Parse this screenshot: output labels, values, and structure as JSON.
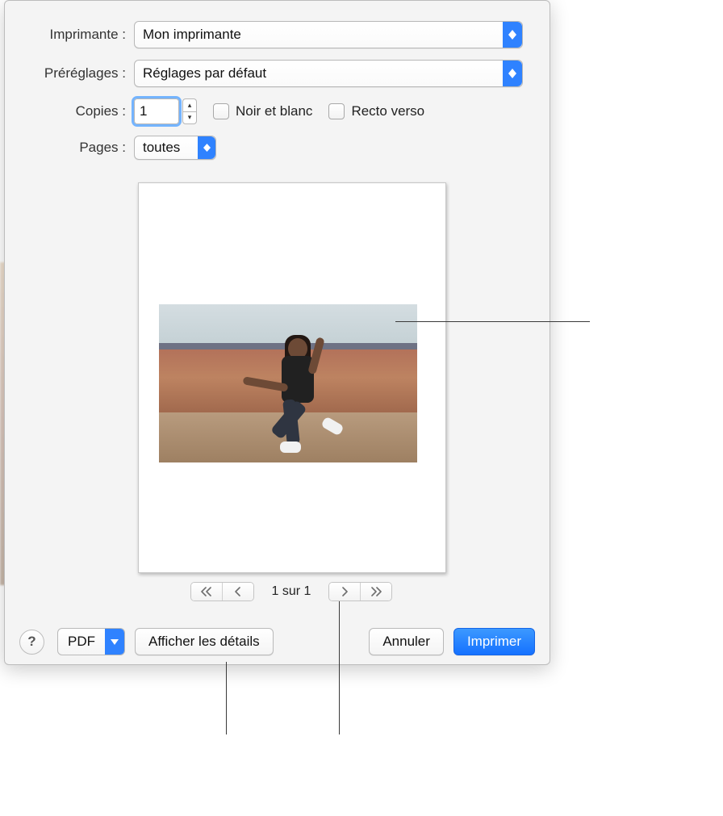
{
  "printer": {
    "label": "Imprimante :",
    "value": "Mon imprimante"
  },
  "presets": {
    "label": "Préréglages :",
    "value": "Réglages par défaut"
  },
  "copies": {
    "label": "Copies :",
    "value": "1"
  },
  "bw": {
    "label": "Noir et blanc"
  },
  "duplex": {
    "label": "Recto verso"
  },
  "pages": {
    "label": "Pages :",
    "value": "toutes"
  },
  "page_indicator": "1 sur 1",
  "buttons": {
    "help": "?",
    "pdf": "PDF",
    "details": "Afficher les détails",
    "cancel": "Annuler",
    "print": "Imprimer"
  }
}
